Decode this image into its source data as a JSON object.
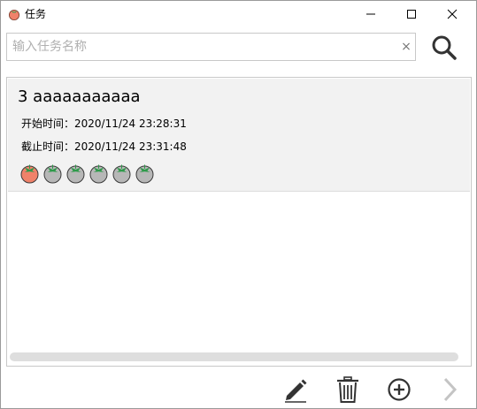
{
  "window": {
    "title": "任务",
    "minimize_label": "",
    "maximize_label": "",
    "close_label": ""
  },
  "search": {
    "placeholder": "输入任务名称",
    "value": "",
    "clear_label": "×"
  },
  "tasks": [
    {
      "title": "3  aaaaaaaaaaa",
      "start_label": "开始时间：2020/11/24 23:28:31",
      "end_label": "截止时间：2020/11/24 23:31:48",
      "pomodoros": {
        "completed": 1,
        "total": 6
      }
    }
  ],
  "toolbar": {
    "icons": [
      "pencil-icon",
      "trash-icon",
      "plus-circle-icon",
      "chevron-right-icon"
    ]
  },
  "colors": {
    "tomato_done": "#f0826a",
    "tomato_pending": "#b7b7b7",
    "leaf": "#2e9a4a",
    "icon_dark": "#333333",
    "icon_disabled": "#c4c4c4"
  }
}
